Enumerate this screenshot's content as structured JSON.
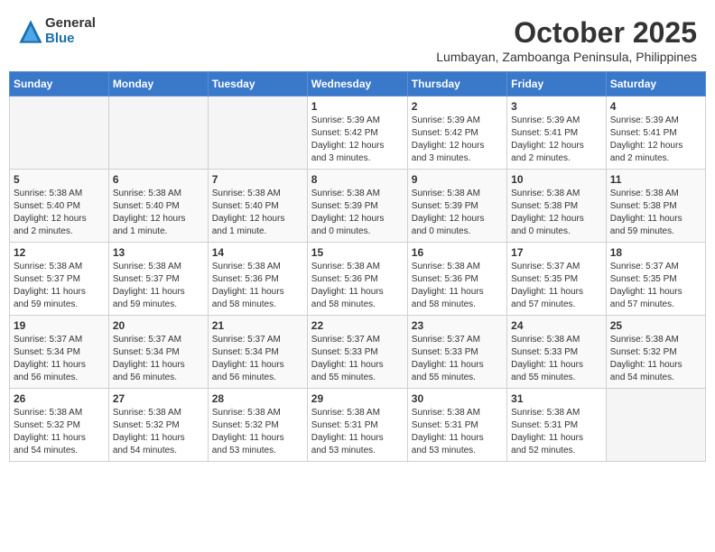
{
  "logo": {
    "general": "General",
    "blue": "Blue"
  },
  "header": {
    "month": "October 2025",
    "location": "Lumbayan, Zamboanga Peninsula, Philippines"
  },
  "weekdays": [
    "Sunday",
    "Monday",
    "Tuesday",
    "Wednesday",
    "Thursday",
    "Friday",
    "Saturday"
  ],
  "weeks": [
    [
      {
        "day": "",
        "info": ""
      },
      {
        "day": "",
        "info": ""
      },
      {
        "day": "",
        "info": ""
      },
      {
        "day": "1",
        "info": "Sunrise: 5:39 AM\nSunset: 5:42 PM\nDaylight: 12 hours\nand 3 minutes."
      },
      {
        "day": "2",
        "info": "Sunrise: 5:39 AM\nSunset: 5:42 PM\nDaylight: 12 hours\nand 3 minutes."
      },
      {
        "day": "3",
        "info": "Sunrise: 5:39 AM\nSunset: 5:41 PM\nDaylight: 12 hours\nand 2 minutes."
      },
      {
        "day": "4",
        "info": "Sunrise: 5:39 AM\nSunset: 5:41 PM\nDaylight: 12 hours\nand 2 minutes."
      }
    ],
    [
      {
        "day": "5",
        "info": "Sunrise: 5:38 AM\nSunset: 5:40 PM\nDaylight: 12 hours\nand 2 minutes."
      },
      {
        "day": "6",
        "info": "Sunrise: 5:38 AM\nSunset: 5:40 PM\nDaylight: 12 hours\nand 1 minute."
      },
      {
        "day": "7",
        "info": "Sunrise: 5:38 AM\nSunset: 5:40 PM\nDaylight: 12 hours\nand 1 minute."
      },
      {
        "day": "8",
        "info": "Sunrise: 5:38 AM\nSunset: 5:39 PM\nDaylight: 12 hours\nand 0 minutes."
      },
      {
        "day": "9",
        "info": "Sunrise: 5:38 AM\nSunset: 5:39 PM\nDaylight: 12 hours\nand 0 minutes."
      },
      {
        "day": "10",
        "info": "Sunrise: 5:38 AM\nSunset: 5:38 PM\nDaylight: 12 hours\nand 0 minutes."
      },
      {
        "day": "11",
        "info": "Sunrise: 5:38 AM\nSunset: 5:38 PM\nDaylight: 11 hours\nand 59 minutes."
      }
    ],
    [
      {
        "day": "12",
        "info": "Sunrise: 5:38 AM\nSunset: 5:37 PM\nDaylight: 11 hours\nand 59 minutes."
      },
      {
        "day": "13",
        "info": "Sunrise: 5:38 AM\nSunset: 5:37 PM\nDaylight: 11 hours\nand 59 minutes."
      },
      {
        "day": "14",
        "info": "Sunrise: 5:38 AM\nSunset: 5:36 PM\nDaylight: 11 hours\nand 58 minutes."
      },
      {
        "day": "15",
        "info": "Sunrise: 5:38 AM\nSunset: 5:36 PM\nDaylight: 11 hours\nand 58 minutes."
      },
      {
        "day": "16",
        "info": "Sunrise: 5:38 AM\nSunset: 5:36 PM\nDaylight: 11 hours\nand 58 minutes."
      },
      {
        "day": "17",
        "info": "Sunrise: 5:37 AM\nSunset: 5:35 PM\nDaylight: 11 hours\nand 57 minutes."
      },
      {
        "day": "18",
        "info": "Sunrise: 5:37 AM\nSunset: 5:35 PM\nDaylight: 11 hours\nand 57 minutes."
      }
    ],
    [
      {
        "day": "19",
        "info": "Sunrise: 5:37 AM\nSunset: 5:34 PM\nDaylight: 11 hours\nand 56 minutes."
      },
      {
        "day": "20",
        "info": "Sunrise: 5:37 AM\nSunset: 5:34 PM\nDaylight: 11 hours\nand 56 minutes."
      },
      {
        "day": "21",
        "info": "Sunrise: 5:37 AM\nSunset: 5:34 PM\nDaylight: 11 hours\nand 56 minutes."
      },
      {
        "day": "22",
        "info": "Sunrise: 5:37 AM\nSunset: 5:33 PM\nDaylight: 11 hours\nand 55 minutes."
      },
      {
        "day": "23",
        "info": "Sunrise: 5:37 AM\nSunset: 5:33 PM\nDaylight: 11 hours\nand 55 minutes."
      },
      {
        "day": "24",
        "info": "Sunrise: 5:38 AM\nSunset: 5:33 PM\nDaylight: 11 hours\nand 55 minutes."
      },
      {
        "day": "25",
        "info": "Sunrise: 5:38 AM\nSunset: 5:32 PM\nDaylight: 11 hours\nand 54 minutes."
      }
    ],
    [
      {
        "day": "26",
        "info": "Sunrise: 5:38 AM\nSunset: 5:32 PM\nDaylight: 11 hours\nand 54 minutes."
      },
      {
        "day": "27",
        "info": "Sunrise: 5:38 AM\nSunset: 5:32 PM\nDaylight: 11 hours\nand 54 minutes."
      },
      {
        "day": "28",
        "info": "Sunrise: 5:38 AM\nSunset: 5:32 PM\nDaylight: 11 hours\nand 53 minutes."
      },
      {
        "day": "29",
        "info": "Sunrise: 5:38 AM\nSunset: 5:31 PM\nDaylight: 11 hours\nand 53 minutes."
      },
      {
        "day": "30",
        "info": "Sunrise: 5:38 AM\nSunset: 5:31 PM\nDaylight: 11 hours\nand 53 minutes."
      },
      {
        "day": "31",
        "info": "Sunrise: 5:38 AM\nSunset: 5:31 PM\nDaylight: 11 hours\nand 52 minutes."
      },
      {
        "day": "",
        "info": ""
      }
    ]
  ]
}
